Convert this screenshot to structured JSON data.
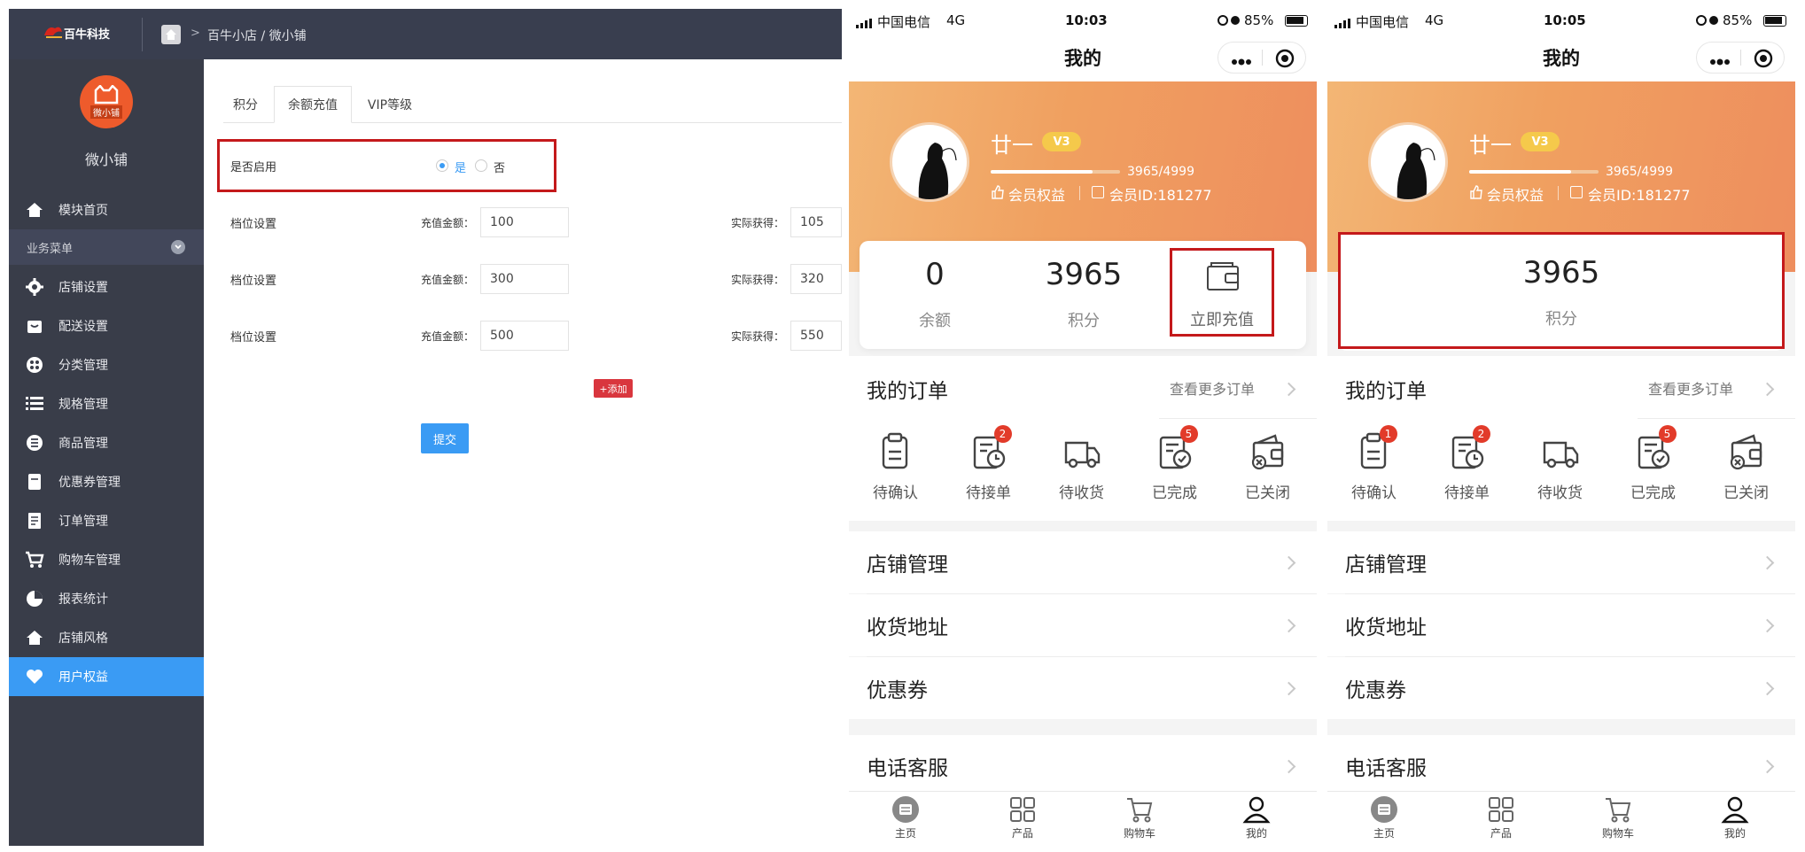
{
  "admin": {
    "logo_text": "百牛科技",
    "breadcrumb": "百牛小店 / 微小铺",
    "shop_logo_text": "微小铺",
    "shop_name": "微小铺",
    "menu": [
      {
        "label": "模块首页",
        "icon": "home-icon"
      },
      {
        "label": "业务菜单",
        "icon": "chevron-down-icon"
      },
      {
        "label": "店铺设置",
        "icon": "gear-icon"
      },
      {
        "label": "配送设置",
        "icon": "bag-icon"
      },
      {
        "label": "分类管理",
        "icon": "category-icon"
      },
      {
        "label": "规格管理",
        "icon": "list-icon"
      },
      {
        "label": "商品管理",
        "icon": "product-list-icon"
      },
      {
        "label": "优惠券管理",
        "icon": "coupon-icon"
      },
      {
        "label": "订单管理",
        "icon": "order-icon"
      },
      {
        "label": "购物车管理",
        "icon": "cart-icon"
      },
      {
        "label": "报表统计",
        "icon": "pie-chart-icon"
      },
      {
        "label": "店铺风格",
        "icon": "home-style-icon"
      },
      {
        "label": "用户权益",
        "icon": "heart-icon"
      }
    ],
    "tabs": [
      "积分",
      "余额充值",
      "VIP等级"
    ],
    "enable_label": "是否启用",
    "radio_yes": "是",
    "radio_no": "否",
    "tiers": [
      {
        "label": "档位设置",
        "amount_label": "充值金额：",
        "amount": "100",
        "get_label": "实际获得：",
        "get": "105"
      },
      {
        "label": "档位设置",
        "amount_label": "充值金额：",
        "amount": "300",
        "get_label": "实际获得：",
        "get": "320"
      },
      {
        "label": "档位设置",
        "amount_label": "充值金额：",
        "amount": "500",
        "get_label": "实际获得：",
        "get": "550"
      }
    ],
    "add_label": "+添加",
    "submit_label": "提交"
  },
  "phone1": {
    "carrier": "中国电信",
    "network": "4G",
    "time": "10:03",
    "battery": "85%",
    "title": "我的",
    "user_name": "廿一",
    "vip": "V3",
    "progress_text": "3965/4999",
    "progress": 0.79,
    "benefits": "会员权益",
    "member_id": "会员ID:181277",
    "balance_value": "0",
    "balance_label": "余额",
    "points_value": "3965",
    "points_label": "积分",
    "recharge_label": "立即充值",
    "orders_title": "我的订单",
    "more_orders": "查看更多订单",
    "order_items": [
      {
        "label": "待确认",
        "badge": ""
      },
      {
        "label": "待接单",
        "badge": "2"
      },
      {
        "label": "待收货",
        "badge": ""
      },
      {
        "label": "已完成",
        "badge": "5"
      },
      {
        "label": "已关闭",
        "badge": ""
      }
    ],
    "menu": [
      "店铺管理",
      "收货地址",
      "优惠券",
      "电话客服"
    ],
    "tabbar": [
      "主页",
      "产品",
      "购物车",
      "我的"
    ]
  },
  "phone2": {
    "carrier": "中国电信",
    "network": "4G",
    "time": "10:05",
    "battery": "85%",
    "title": "我的",
    "user_name": "廿一",
    "vip": "V3",
    "progress_text": "3965/4999",
    "progress": 0.79,
    "benefits": "会员权益",
    "member_id": "会员ID:181277",
    "points_value": "3965",
    "points_label": "积分",
    "orders_title": "我的订单",
    "more_orders": "查看更多订单",
    "order_items": [
      {
        "label": "待确认",
        "badge": "1"
      },
      {
        "label": "待接单",
        "badge": "2"
      },
      {
        "label": "待收货",
        "badge": ""
      },
      {
        "label": "已完成",
        "badge": "5"
      },
      {
        "label": "已关闭",
        "badge": ""
      }
    ],
    "menu": [
      "店铺管理",
      "收货地址",
      "优惠券",
      "电话客服"
    ],
    "tabbar": [
      "主页",
      "产品",
      "购物车",
      "我的"
    ]
  },
  "colors": {
    "accent": "#3a9bf4",
    "sidebar": "#393d49",
    "highlight": "#c4191b",
    "badge": "#e23b2a",
    "hero": "#f0a060"
  }
}
